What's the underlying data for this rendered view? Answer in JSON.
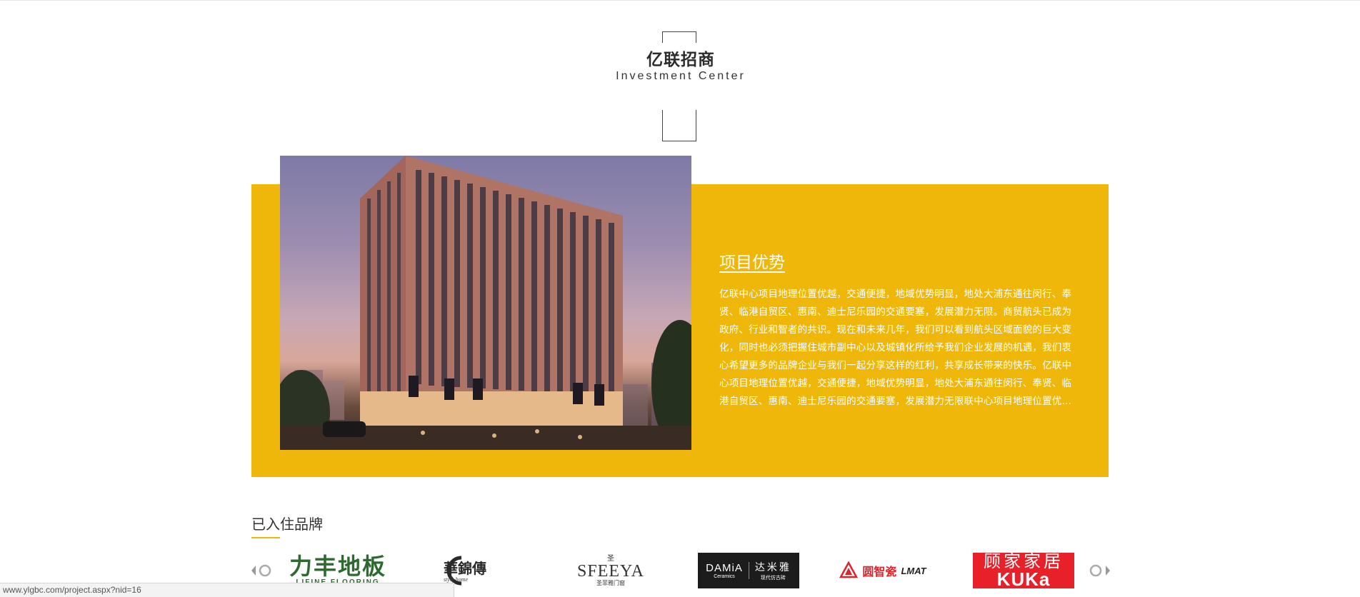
{
  "section": {
    "title_cn": "亿联招商",
    "title_en": "Investment Center"
  },
  "feature": {
    "title": "项目优势",
    "body": "亿联中心项目地理位置优越，交通便捷，地域优势明显，地处大浦东通往闵行、奉贤、临港自贸区、惠南、迪士尼乐园的交通要塞，发展潜力无限。商贸航头已成为政府、行业和智者的共识。现在和未来几年，我们可以看到航头区域面貌的巨大变化，同时也必须把握住城市副中心以及城镇化所给予我们企业发展的机遇，我们衷心希望更多的品牌企业与我们一起分享这样的红利，共享成长带来的快乐。亿联中心项目地理位置优越，交通便捷，地域优势明显，地处大浦东通往闵行、奉贤、临港自贸区、惠南、迪士尼乐园的交通要塞，发展潜力无限联中心项目地理位置优..."
  },
  "brands": {
    "title": "已入住品牌",
    "items": [
      {
        "cn": "力丰地板",
        "en": "LIFINE FLOORING"
      },
      {
        "cn": "華錦傳",
        "en": "style home"
      },
      {
        "mark": "圣",
        "word": "SFEEYA",
        "sub": "圣菲雅门窗"
      },
      {
        "word": "DAMiA",
        "sub": "Ceramics",
        "cn": "达米雅",
        "cn_sub": "现代仿古砖"
      },
      {
        "cn": "圆智瓷",
        "en": "LMAT"
      },
      {
        "cn": "顾家家居",
        "en": "KUKa"
      }
    ]
  },
  "status_bar": {
    "url": "www.ylgbc.com/project.aspx?nid=16"
  },
  "colors": {
    "accent": "#f0b70b",
    "lifine_green": "#2e6a2f",
    "kuka_red": "#e8202a",
    "guyi_red": "#d9262c"
  }
}
